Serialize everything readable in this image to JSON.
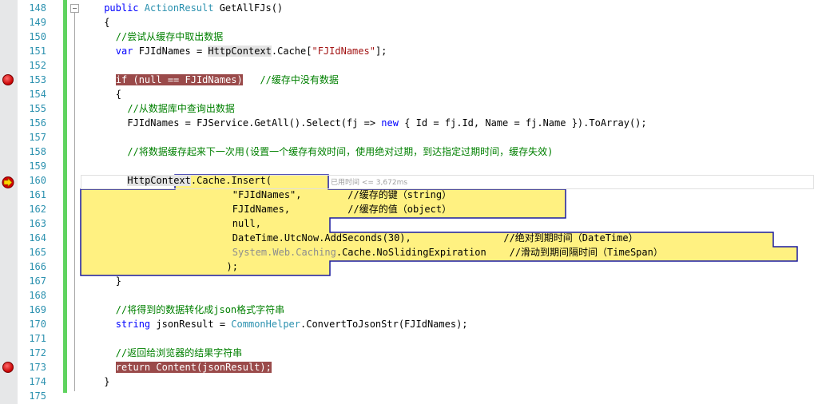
{
  "editor": {
    "colors": {
      "keyword": "#0000ff",
      "type": "#2b91af",
      "string": "#a31515",
      "comment": "#008000",
      "breakpoint_line": "#9a4a4a",
      "current_statement": "#fff181",
      "line_number": "#2b91af",
      "change_bar": "#5fd35f"
    },
    "lines": [
      {
        "num": "148",
        "indent": 4,
        "tokens": [
          {
            "t": "public ",
            "c": "kw"
          },
          {
            "t": "ActionResult ",
            "c": "ty"
          },
          {
            "t": "GetAllFJs()",
            "c": ""
          }
        ]
      },
      {
        "num": "149",
        "indent": 4,
        "tokens": [
          {
            "t": "{",
            "c": ""
          }
        ]
      },
      {
        "num": "150",
        "indent": 6,
        "tokens": [
          {
            "t": "//尝试从缓存中取出数据",
            "c": "cm"
          }
        ]
      },
      {
        "num": "151",
        "indent": 6,
        "tokens": [
          {
            "t": "var ",
            "c": "kw"
          },
          {
            "t": "FJIdNames = ",
            "c": ""
          },
          {
            "t": "HttpContext",
            "c": "ref-hl"
          },
          {
            "t": ".Cache[",
            "c": ""
          },
          {
            "t": "\"FJIdNames\"",
            "c": "str"
          },
          {
            "t": "];",
            "c": ""
          }
        ]
      },
      {
        "num": "152",
        "indent": 0,
        "tokens": []
      },
      {
        "num": "153",
        "indent": 6,
        "breakpoint": true,
        "tokens": [
          {
            "t": "if (null == FJIdNames)",
            "c": "bp-hl"
          },
          {
            "t": "   ",
            "c": ""
          },
          {
            "t": "//缓存中没有数据",
            "c": "cm"
          }
        ]
      },
      {
        "num": "154",
        "indent": 6,
        "tokens": [
          {
            "t": "{",
            "c": ""
          }
        ]
      },
      {
        "num": "155",
        "indent": 8,
        "tokens": [
          {
            "t": "//从数据库中查询出数据",
            "c": "cm"
          }
        ]
      },
      {
        "num": "156",
        "indent": 8,
        "tokens": [
          {
            "t": "FJIdNames = FJService.GetAll().Select(fj => ",
            "c": ""
          },
          {
            "t": "new",
            "c": "kw"
          },
          {
            "t": " { Id = fj.Id, Name = fj.Name }).ToArray();",
            "c": ""
          }
        ]
      },
      {
        "num": "157",
        "indent": 0,
        "tokens": []
      },
      {
        "num": "158",
        "indent": 8,
        "tokens": [
          {
            "t": "//将数据缓存起来下一次用(设置一个缓存有效时间，使用绝对过期，到达指定过期时间，缓存失效)",
            "c": "cm"
          }
        ]
      },
      {
        "num": "159",
        "indent": 0,
        "tokens": []
      },
      {
        "num": "160",
        "indent": 8,
        "current": true,
        "tokens": [
          {
            "t": "HttpContext",
            "c": "ref-hl"
          },
          {
            "t": ".Cache.Insert(",
            "c": ""
          }
        ]
      },
      {
        "num": "161",
        "indent": 26,
        "tokens": [
          {
            "t": "\"FJIdNames\",",
            "c": ""
          },
          {
            "t": "        ",
            "c": ""
          },
          {
            "t": "//缓存的键（string）",
            "c": ""
          }
        ]
      },
      {
        "num": "162",
        "indent": 26,
        "tokens": [
          {
            "t": "FJIdNames,",
            "c": ""
          },
          {
            "t": "          ",
            "c": ""
          },
          {
            "t": "//缓存的值（object）",
            "c": ""
          }
        ]
      },
      {
        "num": "163",
        "indent": 26,
        "tokens": [
          {
            "t": "null,",
            "c": ""
          }
        ]
      },
      {
        "num": "164",
        "indent": 26,
        "tokens": [
          {
            "t": "DateTime.UtcNow.AddSeconds(30),",
            "c": ""
          },
          {
            "t": "                ",
            "c": ""
          },
          {
            "t": "//绝对到期时间（DateTime）",
            "c": ""
          }
        ]
      },
      {
        "num": "165",
        "indent": 26,
        "tokens": [
          {
            "t": "System.Web.Caching",
            "c": "gray"
          },
          {
            "t": ".Cache.NoSlidingExpiration",
            "c": ""
          },
          {
            "t": "    ",
            "c": ""
          },
          {
            "t": "//滑动到期间隔时间（TimeSpan）",
            "c": ""
          }
        ]
      },
      {
        "num": "166",
        "indent": 25,
        "tokens": [
          {
            "t": ");",
            "c": ""
          }
        ]
      },
      {
        "num": "167",
        "indent": 6,
        "tokens": [
          {
            "t": "}",
            "c": ""
          }
        ]
      },
      {
        "num": "168",
        "indent": 0,
        "tokens": []
      },
      {
        "num": "169",
        "indent": 6,
        "tokens": [
          {
            "t": "//将得到的数据转化成json格式字符串",
            "c": "cm"
          }
        ]
      },
      {
        "num": "170",
        "indent": 6,
        "tokens": [
          {
            "t": "string ",
            "c": "kw"
          },
          {
            "t": "jsonResult = ",
            "c": ""
          },
          {
            "t": "CommonHelper",
            "c": "ty"
          },
          {
            "t": ".ConvertToJsonStr(FJIdNames);",
            "c": ""
          }
        ]
      },
      {
        "num": "171",
        "indent": 0,
        "tokens": []
      },
      {
        "num": "172",
        "indent": 6,
        "tokens": [
          {
            "t": "//返回给浏览器的结果字符串",
            "c": "cm"
          }
        ]
      },
      {
        "num": "173",
        "indent": 6,
        "breakpoint": true,
        "tokens": [
          {
            "t": "return Content(jsonResult);",
            "c": "bp-hl"
          }
        ]
      },
      {
        "num": "174",
        "indent": 4,
        "tokens": [
          {
            "t": "}",
            "c": ""
          }
        ]
      },
      {
        "num": "175",
        "indent": 0,
        "tokens": []
      }
    ],
    "perf_tip": "已用时间 <= 3,672ms"
  }
}
